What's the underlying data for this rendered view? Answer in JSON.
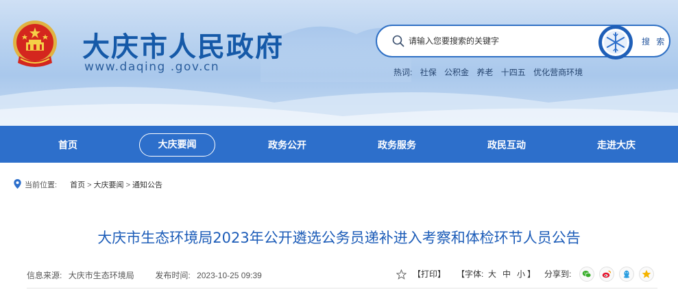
{
  "header": {
    "site_title": "大庆市人民政府",
    "site_domain": "www.daqing .gov.cn"
  },
  "search": {
    "placeholder": "请输入您要搜索的关键字",
    "button_label": "搜 索"
  },
  "hotwords": {
    "label": "热词:",
    "items": [
      "社保",
      "公积金",
      "养老",
      "十四五",
      "优化营商环境"
    ]
  },
  "nav": {
    "items": [
      {
        "label": "首页"
      },
      {
        "label": "大庆要闻",
        "active": true
      },
      {
        "label": "政务公开"
      },
      {
        "label": "政务服务"
      },
      {
        "label": "政民互动"
      },
      {
        "label": "走进大庆"
      }
    ]
  },
  "breadcrumb": {
    "prefix": "当前位置:",
    "items": [
      "首页",
      "大庆要闻",
      "通知公告"
    ],
    "separator": ">"
  },
  "article": {
    "title": "大庆市生态环境局2023年公开遴选公务员递补进入考察和体检环节人员公告",
    "source_label": "信息来源:",
    "source": "大庆市生态环境局",
    "time_label": "发布时间:",
    "time": "2023-10-25 09:39"
  },
  "tools": {
    "print": "【打印】",
    "font_label": "【字体:",
    "font_large": "大",
    "font_medium": "中",
    "font_small": "小",
    "font_close": "】",
    "share_label": "分享到:",
    "share_icons": [
      "wechat-icon",
      "weibo-icon",
      "qq-icon",
      "qzone-icon"
    ]
  },
  "colors": {
    "brand_blue": "#2d6fcb",
    "title_blue": "#1c5cb8",
    "site_title_blue": "#1559a8"
  }
}
